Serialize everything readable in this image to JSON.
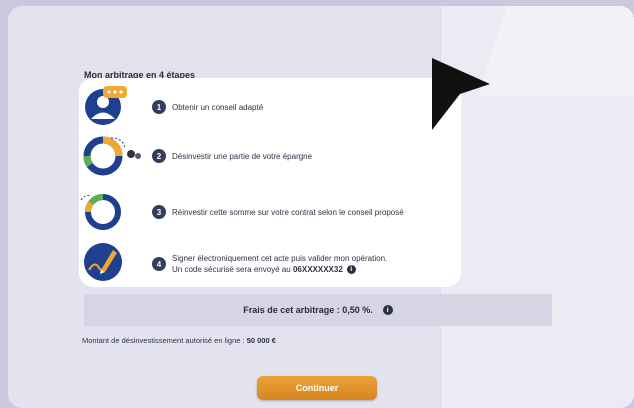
{
  "section_title": "Mon arbitrage en 4 étapes",
  "steps": [
    {
      "number": "1",
      "text": "Obtenir un conseil adapté",
      "icon": "advisor-icon"
    },
    {
      "number": "2",
      "text": "Désinvestir une partie de votre épargne",
      "icon": "divest-donut-icon"
    },
    {
      "number": "3",
      "text": "Réinvestir cette somme sur votre contrat selon le conseil proposé",
      "icon": "reinvest-donut-icon"
    },
    {
      "number": "4",
      "text_line1": "Signer électroniquement cet acte puis valider mon opération.",
      "text_line2_prefix": "Un code sécurisé sera envoyé au",
      "phone": "06XXXXXX32",
      "icon": "signature-pen-icon"
    }
  ],
  "info_glyph": "i",
  "fees": {
    "label": "Frais de cet arbitrage : 0,50 %."
  },
  "amount": {
    "label": "Montant de désinvestissement autorisé en ligne :",
    "value": "50 000 €"
  },
  "continue_button": "Continuer",
  "colors": {
    "accent_orange": "#e8a03a",
    "navy": "#1f3f8f",
    "green": "#5bb04f",
    "background": "#e3e3ef"
  }
}
